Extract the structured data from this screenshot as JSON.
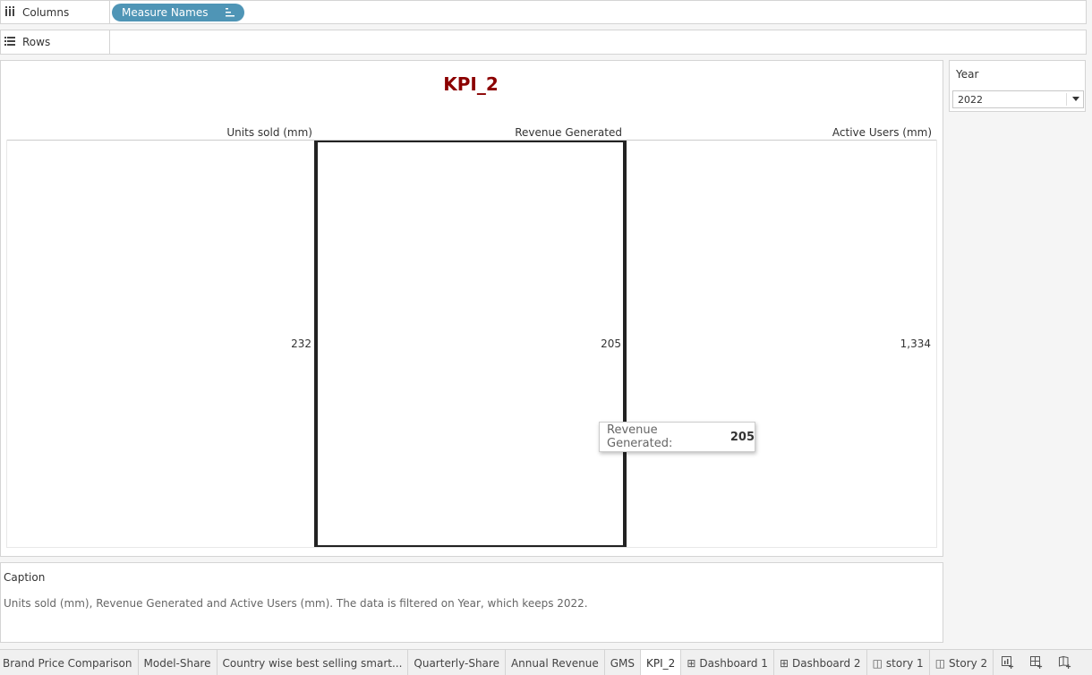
{
  "shelves": {
    "columns_label": "Columns",
    "rows_label": "Rows",
    "columns_pill": "Measure Names"
  },
  "sheet": {
    "title": "KPI_2",
    "title_color": "#8b0000"
  },
  "chart_data": {
    "type": "table",
    "categories": [
      "Units sold (mm)",
      "Revenue Generated",
      "Active Users (mm)"
    ],
    "values": [
      232,
      205,
      1334
    ],
    "value_labels": [
      "232",
      "205",
      "1,334"
    ],
    "highlighted": "Revenue Generated"
  },
  "tooltip": {
    "key": "Revenue Generated:",
    "value": "205"
  },
  "filter": {
    "label": "Year",
    "selected": "2022"
  },
  "caption": {
    "heading": "Caption",
    "text": "Units sold (mm), Revenue Generated and Active Users (mm). The data is filtered on Year, which keeps 2022."
  },
  "tabs": [
    {
      "label": "Brand Price Comparison",
      "icon": "",
      "active": false
    },
    {
      "label": "Model-Share",
      "icon": "",
      "active": false
    },
    {
      "label": "Country wise best selling smart...",
      "icon": "",
      "active": false
    },
    {
      "label": "Quarterly-Share",
      "icon": "",
      "active": false
    },
    {
      "label": "Annual Revenue",
      "icon": "",
      "active": false
    },
    {
      "label": "GMS",
      "icon": "",
      "active": false
    },
    {
      "label": "KPI_2",
      "icon": "",
      "active": true
    },
    {
      "label": "Dashboard 1",
      "icon": "dashboard-icon",
      "active": false
    },
    {
      "label": "Dashboard 2",
      "icon": "dashboard-icon",
      "active": false
    },
    {
      "label": "story 1",
      "icon": "story-icon",
      "active": false
    },
    {
      "label": "Story 2",
      "icon": "story-icon",
      "active": false
    }
  ],
  "new_tab_icons": [
    "new-worksheet-icon",
    "new-dashboard-icon",
    "new-story-icon"
  ],
  "colors": {
    "pill": "#4f95b6",
    "highlight_border": "#222222"
  }
}
